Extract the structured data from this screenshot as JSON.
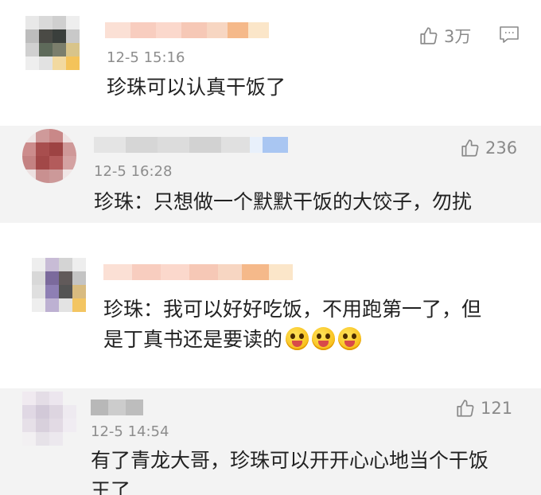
{
  "comments": [
    {
      "time": "12-5 15:16",
      "text_lines": [
        "珍珠可以认真干饭了"
      ],
      "likes": "3万",
      "icons": [
        "thumbs-up-icon",
        "comment-icon"
      ]
    },
    {
      "time": "12-5 16:28",
      "text_lines": [
        "珍珠：只想做一个默默干饭的大饺子，勿扰"
      ],
      "likes": "236",
      "icons": [
        "thumbs-up-icon"
      ]
    },
    {
      "time": "",
      "text_lines": [
        "珍珠：我可以好好吃饭，不用跑第一了，但",
        "是丁真书还是要读的"
      ],
      "emoji": [
        "grinning-tongue-emoji",
        "grinning-tongue-emoji",
        "grinning-tongue-emoji"
      ]
    },
    {
      "time": "12-5 14:54",
      "text_lines": [
        "有了青龙大哥，珍珠可以开开心心地当个干饭",
        "王了"
      ],
      "likes": "121",
      "icons": [
        "thumbs-up-icon"
      ]
    }
  ],
  "colors": {
    "background_white": "#ffffff",
    "background_grey": "#f3f3f3",
    "timestamp": "#8d8d8d",
    "icon": "#8a8a8a"
  }
}
